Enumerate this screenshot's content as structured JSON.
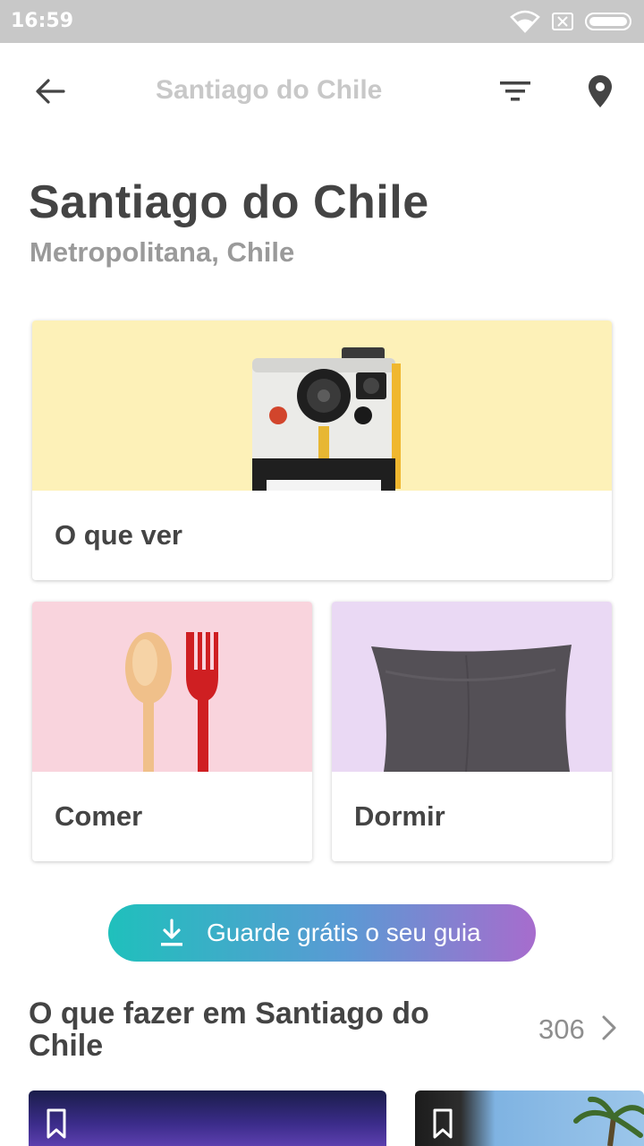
{
  "status_bar": {
    "time": "16:59"
  },
  "app_bar": {
    "title": "Santiago do Chile",
    "icons": [
      "arrow-back-icon",
      "filter-icon",
      "map-pin-icon"
    ]
  },
  "header": {
    "title": "Santiago do Chile",
    "subtitle": "Metropolitana, Chile"
  },
  "categories": [
    {
      "label": "O que ver",
      "image": "polaroid-camera",
      "bg": "#fdf1b8"
    },
    {
      "label": "Comer",
      "image": "spoon-and-fork",
      "bg": "#f9d4dd"
    },
    {
      "label": "Dormir",
      "image": "pillow",
      "bg": "#ead9f4"
    }
  ],
  "save_button": {
    "label": "Guarde grátis o seu guia",
    "icon": "download-icon",
    "gradient": [
      "#1fc0bc",
      "#a76ccd"
    ]
  },
  "section": {
    "title": "O que fazer em Santiago do Chile",
    "count": "306"
  },
  "colors": {
    "text_primary": "#444444",
    "text_secondary": "#9a9a9a",
    "appbar_title": "#c8c8c8"
  }
}
